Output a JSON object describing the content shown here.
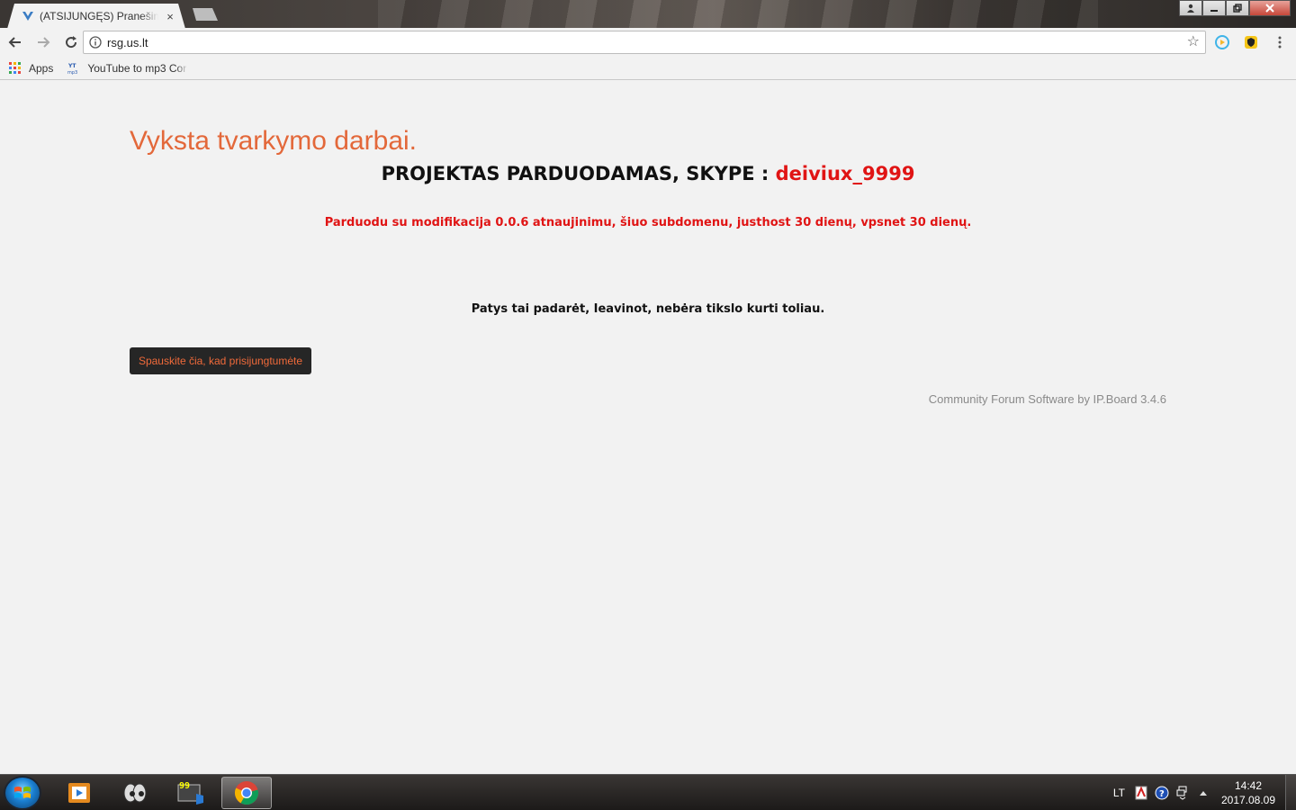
{
  "browser": {
    "tab_title": "(ATSIJUNGĘS) Pranešima",
    "tab_close": "×",
    "url": "rsg.us.lt",
    "star": "☆"
  },
  "bookmarks": {
    "items": [
      {
        "label": "Apps",
        "icon": "apps-grid-icon"
      },
      {
        "label": "YouTube to mp3 Cor",
        "icon": "yt-mp3-icon"
      }
    ]
  },
  "page": {
    "heading": "Vyksta tvarkymo darbai.",
    "project_prefix": "PROJEKTAS PARDUODAMAS, SKYPE : ",
    "skype_name": "deiviux_9999",
    "sale_line": "Parduodu su modifikacija 0.0.6 atnaujinimu, šiuo subdomenu, justhost 30 dienų, vpsnet 30 dienų.",
    "self_line": "Patys tai padarėt, Ieavinot, nebėra tikslo kurti toliau.",
    "login_button": "Spauskite čia, kad prisijungtumėte",
    "footer_credit": "Community Forum Software by IP.Board 3.4.6"
  },
  "taskbar": {
    "language": "LT",
    "time": "14:42",
    "date": "2017.08.09"
  },
  "colors": {
    "heading": "#e3683a",
    "alert_red": "#e01414",
    "button_bg": "#262626",
    "button_text": "#f06a3a",
    "page_bg": "#f2f2f2"
  }
}
